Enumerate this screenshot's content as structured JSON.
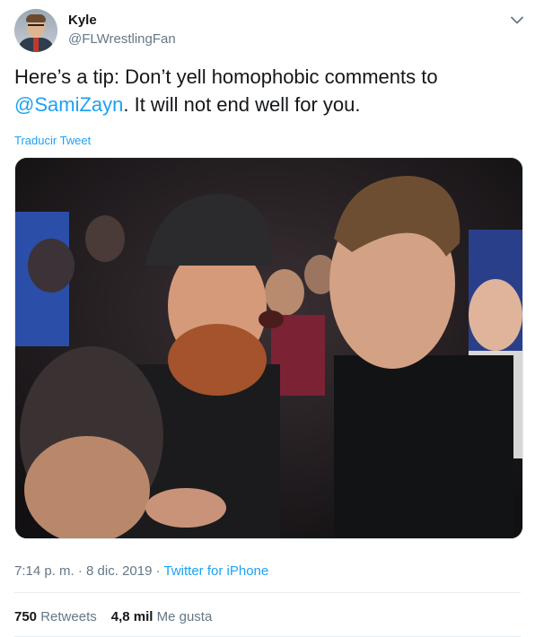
{
  "author": {
    "name": "Kyle",
    "handle": "@FLWrestlingFan"
  },
  "tweet": {
    "text_before": "Here’s a tip: Don’t yell homophobic comments to ",
    "mention": "@SamiZayn",
    "text_after": ". It will not end well for you.",
    "translate_label": "Traducir Tweet"
  },
  "meta": {
    "time": "7:14 p. m.",
    "separator1": " · ",
    "date": "8 dic. 2019",
    "separator2": " · ",
    "source": "Twitter for iPhone"
  },
  "stats": {
    "retweets_count": "750",
    "retweets_label": "Retweets",
    "likes_count": "4,8 mil",
    "likes_label": "Me gusta"
  },
  "icons": {
    "caret": "chevron-down-icon"
  },
  "colors": {
    "link": "#1da1f2",
    "secondary_text": "#657786",
    "primary_text": "#14171a"
  }
}
